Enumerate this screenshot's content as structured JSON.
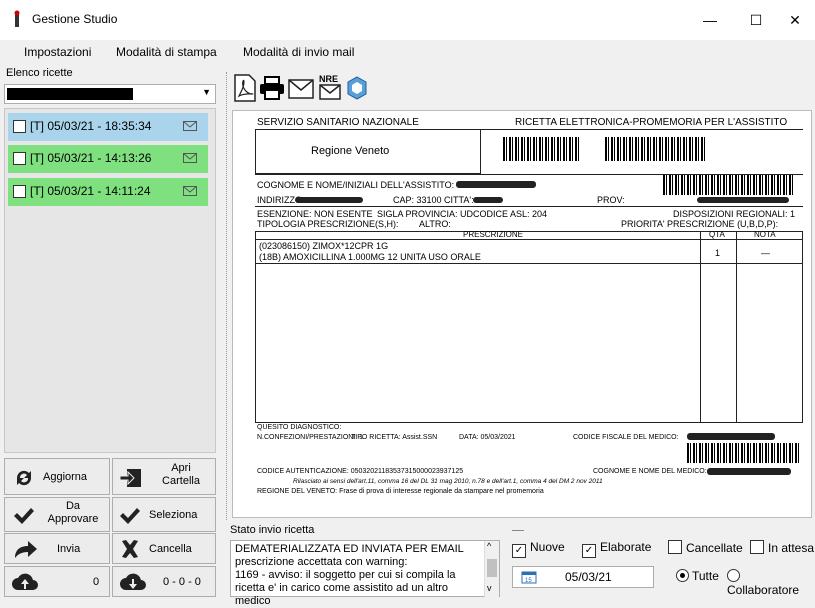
{
  "window": {
    "title": "Gestione Studio",
    "minimize": "—",
    "maximize": "☐",
    "close": "✕"
  },
  "menu": [
    "Impostazioni",
    "Modalità di stampa",
    "Modalità di invio mail"
  ],
  "left": {
    "list_label": "Elenco ricette",
    "items": [
      {
        "label": "[T] 05/03/21 - 18:35:34",
        "color": "#a9d4ec"
      },
      {
        "label": "[T] 05/03/21 - 14:13:26",
        "color": "#7fe07f"
      },
      {
        "label": "[T] 05/03/21 - 14:11:24",
        "color": "#7fe07f"
      }
    ],
    "buttons": {
      "aggiorna": "Aggiorna",
      "apri_cartella": "Apri Cartella",
      "da_approvare": "Da Approvare",
      "seleziona": "Seleziona",
      "invia": "Invia",
      "cancella": "Cancella",
      "upload_count": "0",
      "download_count": "0 - 0 - 0"
    }
  },
  "document": {
    "ssn": "SERVIZIO SANITARIO NAZIONALE",
    "header_right": "RICETTA ELETTRONICA-PROMEMORIA PER L'ASSISTITO",
    "regione": "Regione Veneto",
    "cognome": "COGNOME E NOME/INIZIALI DELL'ASSISTITO:",
    "indirizzo": "INDIRIZZO:",
    "cap": "CAP: 33100 CITTA':",
    "prov": "PROV:",
    "esenzione": "ESENZIONE: NON ESENTE",
    "sigla": "SIGLA PROVINCIA: UD",
    "asl": "CODICE ASL: 204",
    "disposizioni": "DISPOSIZIONI REGIONALI: 1",
    "tipologia": "TIPOLOGIA PRESCRIZIONE(S,H):",
    "altro": "ALTRO:",
    "priorita": "PRIORITA' PRESCRIZIONE (U,B,D,P):",
    "col_prescrizione": "PRESCRIZIONE",
    "col_qta": "QTA",
    "col_nota": "NOTA",
    "presc_line1": "(023086150) ZIMOX*12CPR 1G",
    "presc_line2": "(18B) AMOXICILLINA 1.000MG 12 UNITA USO ORALE",
    "qta_value": "1",
    "nota_value": "—",
    "quesito": "QUESITO DIAGNOSTICO:",
    "nconf": "N.CONFEZIONI/PRESTAZIONI: 1",
    "tipo": "TIPO RICETTA: Assist.SSN",
    "data": "DATA: 05/03/2021",
    "cf_medico": "CODICE FISCALE DEL MEDICO:",
    "codice_aut": "CODICE AUTENTICAZIONE: 05032021183537315000023937125",
    "cognome_medico": "COGNOME E NOME DEL MEDICO:",
    "rilasciato": "Rilasciato ai sensi dell'art.11, comma 16 del DL 31 mag 2010, n.78 e dell'art.1, comma 4 del DM 2 nov 2011",
    "regione_note": "REGIONE DEL VENETO: Frase di prova di interesse regionale da stampare nel promemoria"
  },
  "status": {
    "label": "Stato invio ricetta",
    "text": "DEMATERIALIZZATA ED INVIATA PER EMAIL\nprescrizione accettata con warning:\n1169 - avviso: il soggetto per cui si compila la ricetta e' in carico come assistito ad un altro medico"
  },
  "filters": {
    "nuove": "Nuove",
    "elaborate": "Elaborate",
    "cancellate": "Cancellate",
    "in_attesa": "In attesa",
    "date": "05/03/21",
    "tutte": "Tutte",
    "collaboratore": "Collaboratore"
  }
}
